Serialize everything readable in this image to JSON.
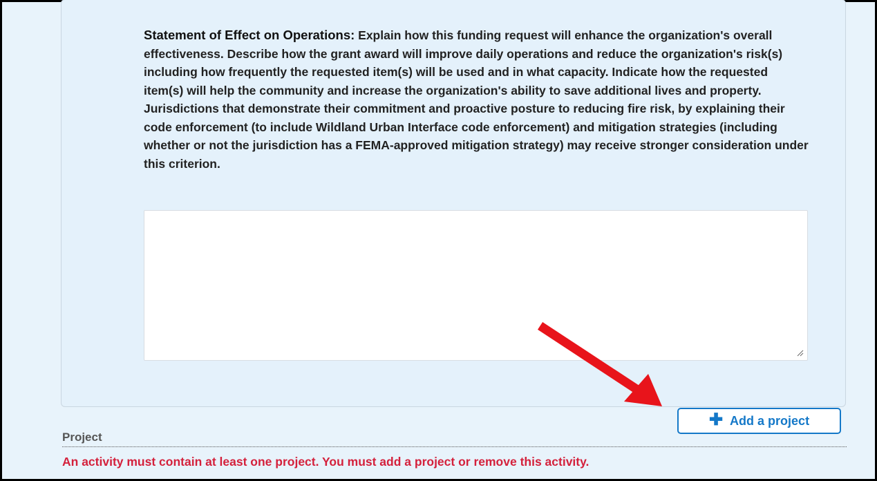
{
  "statement": {
    "lead": "Statement of Effect on Operations:",
    "text": "Explain how this funding request will enhance the organization's overall effectiveness. Describe how the grant award will improve daily operations and reduce the organization's risk(s) including how frequently the requested item(s) will be used and in what capacity. Indicate how the requested item(s) will help the community and increase the organization's ability to save additional lives and property. Jurisdictions that demonstrate their commitment and proactive posture to reducing fire risk, by explaining their code enforcement (to include Wildland Urban Interface code enforcement) and mitigation strategies (including whether or not the jurisdiction has a FEMA-approved mitigation strategy) may receive stronger consideration under this criterion.",
    "answer_value": ""
  },
  "add_project_button": {
    "label": "Add a project",
    "icon": "plus-icon"
  },
  "project_section": {
    "label": "Project",
    "error": "An activity must contain at least one project. You must add a project or remove this activity."
  },
  "annotation": {
    "color": "#e8141b",
    "icon": "red-arrow"
  }
}
